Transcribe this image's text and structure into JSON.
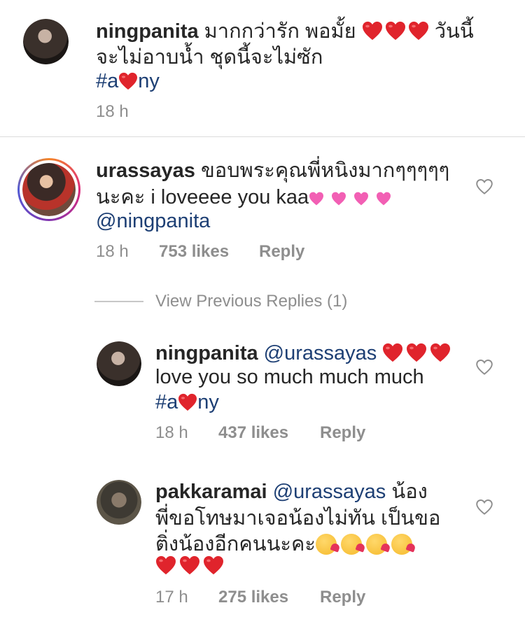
{
  "colors": {
    "mention": "#1d3f74",
    "meta": "#8e8e8e",
    "heart": "#e0242c",
    "like_icon": "#8e8e8e"
  },
  "comment1": {
    "username": "ningpanita",
    "line1_text": "มากกว่ารัก พอมั้ย",
    "line1_after": "วันนี้",
    "line2": "จะไม่อาบน้ำ ชุดนี้จะไม่ซัก",
    "tag_prefix": "#a",
    "tag_suffix": "ny",
    "time": "18 h"
  },
  "comment2": {
    "username": "urassayas",
    "line1_text": "ขอบพระคุณพี่หนิงมากๆๆๆๆๆ",
    "line2": "นะคะ i loveeee you kaa",
    "mention": "@ningpanita",
    "time": "18 h",
    "likes": "753 likes",
    "reply": "Reply"
  },
  "view_previous": "View Previous Replies (1)",
  "reply1": {
    "username": "ningpanita",
    "mention": "@urassayas",
    "line2": "love you so much much much",
    "tag_prefix": "#a",
    "tag_suffix": "ny",
    "time": "18 h",
    "likes": "437 likes",
    "reply": "Reply"
  },
  "reply2": {
    "username": "pakkaramai",
    "mention": "@urassayas",
    "line1_after": "น้อง",
    "line2": "พี่ขอโทษมาเจอน้องไม่ทัน เป็นขอ",
    "line3": "ติ่งน้องอีกคนนะคะ",
    "time": "17 h",
    "likes": "275 likes",
    "reply": "Reply"
  }
}
